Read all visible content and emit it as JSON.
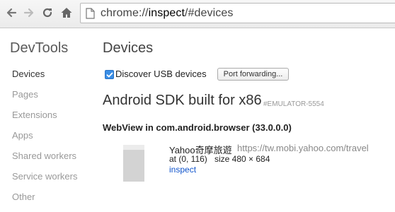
{
  "toolbar": {
    "back_icon": "back-arrow-icon",
    "forward_icon": "forward-arrow-icon",
    "reload_icon": "reload-icon",
    "home_icon": "home-icon",
    "url_scheme": "chrome://",
    "url_host": "inspect",
    "url_path": "/#devices"
  },
  "sidebar": {
    "title": "DevTools",
    "items": [
      {
        "label": "Devices",
        "selected": true
      },
      {
        "label": "Pages"
      },
      {
        "label": "Extensions"
      },
      {
        "label": "Apps"
      },
      {
        "label": "Shared workers"
      },
      {
        "label": "Service workers"
      },
      {
        "label": "Other"
      }
    ]
  },
  "main": {
    "title": "Devices",
    "discover_usb_label": "Discover USB devices",
    "discover_usb_checked": true,
    "port_forwarding_label": "Port forwarding...",
    "device": {
      "name": "Android SDK built for x86",
      "serial": "#EMULATOR-5554",
      "browser": "WebView in com.android.browser (33.0.0.0)",
      "page": {
        "title": "Yahoo奇摩旅遊",
        "url": "https://tw.mobi.yahoo.com/travel",
        "position": "at (0, 116)",
        "size": "size 480 × 684",
        "inspect_label": "inspect"
      }
    }
  },
  "colors": {
    "accent_blue": "#3a8ee6",
    "link_blue": "#1155cc"
  }
}
